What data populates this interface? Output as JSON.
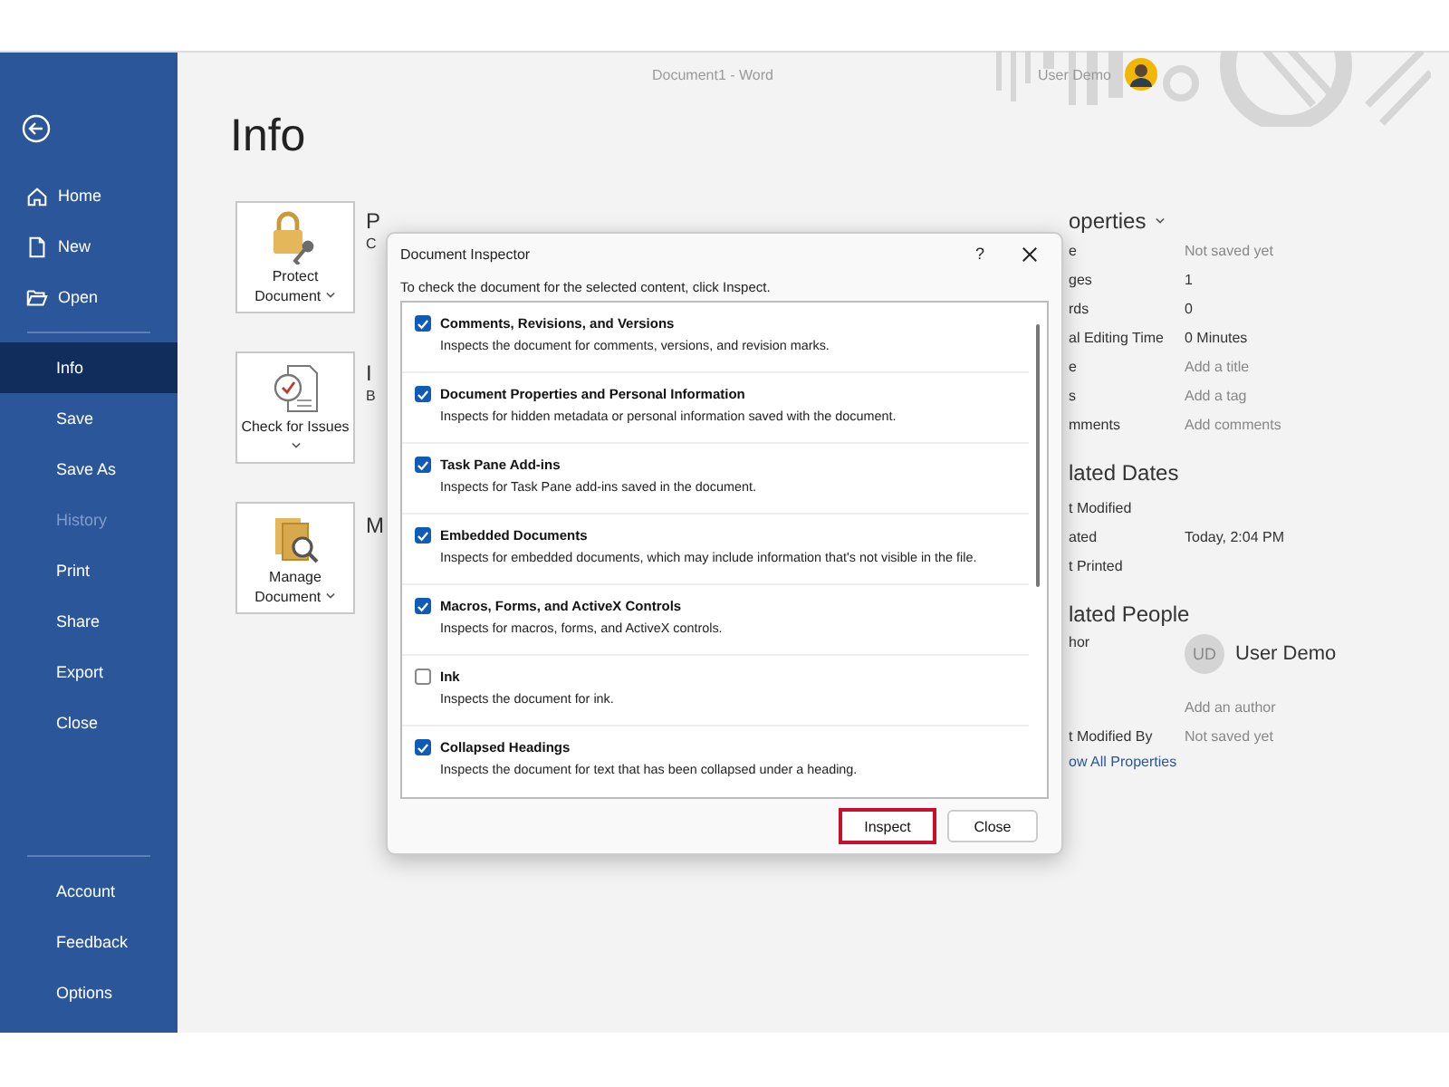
{
  "window": {
    "title": "Document1  -  Word",
    "user": "User Demo"
  },
  "sidebar": {
    "top": [
      {
        "label": "Home"
      },
      {
        "label": "New"
      },
      {
        "label": "Open"
      }
    ],
    "middle": [
      {
        "label": "Info",
        "selected": true,
        "disabled": false
      },
      {
        "label": "Save",
        "selected": false,
        "disabled": false
      },
      {
        "label": "Save As",
        "selected": false,
        "disabled": false
      },
      {
        "label": "History",
        "selected": false,
        "disabled": true
      },
      {
        "label": "Print",
        "selected": false,
        "disabled": false
      },
      {
        "label": "Share",
        "selected": false,
        "disabled": false
      },
      {
        "label": "Export",
        "selected": false,
        "disabled": false
      },
      {
        "label": "Close",
        "selected": false,
        "disabled": false
      }
    ],
    "bottom": [
      {
        "label": "Account"
      },
      {
        "label": "Feedback"
      },
      {
        "label": "Options"
      }
    ]
  },
  "page_title": "Info",
  "tools": [
    {
      "label": "Protect Document",
      "fragments": [
        "P",
        "C"
      ]
    },
    {
      "label": "Check for Issues",
      "fragments": [
        "I",
        "B"
      ]
    },
    {
      "label": "Manage Document",
      "fragments": [
        "M"
      ]
    }
  ],
  "properties": {
    "heading": "operties",
    "rows": [
      {
        "label": "e",
        "value": "Not saved yet",
        "muted": true
      },
      {
        "label": "ges",
        "value": "1",
        "muted": false
      },
      {
        "label": "rds",
        "value": "0",
        "muted": false
      },
      {
        "label": "al Editing Time",
        "value": "0 Minutes",
        "muted": false
      },
      {
        "label": "e",
        "value": "Add a title",
        "muted": true
      },
      {
        "label": "s",
        "value": "Add a tag",
        "muted": true
      },
      {
        "label": "mments",
        "value": "Add comments",
        "muted": true
      }
    ],
    "dates_heading": "lated Dates",
    "dates": [
      {
        "label": "t Modified"
      },
      {
        "label": "ated",
        "value": "Today, 2:04 PM"
      },
      {
        "label": "t Printed"
      }
    ],
    "people_heading": "lated People",
    "author_label": "hor",
    "author_initials": "UD",
    "author_name": "User Demo",
    "add_author": "Add an author",
    "modified_by_label": "t Modified By",
    "modified_by_value": "Not saved yet",
    "link": "ow All Properties"
  },
  "dialog": {
    "title": "Document Inspector",
    "help": "?",
    "instruction": "To check the document for the selected content, click Inspect.",
    "items": [
      {
        "title": "Comments, Revisions, and Versions",
        "description": "Inspects the document for comments, versions, and revision marks.",
        "checked": true
      },
      {
        "title": "Document Properties and Personal Information",
        "description": "Inspects for hidden metadata or personal information saved with the document.",
        "checked": true
      },
      {
        "title": "Task Pane Add-ins",
        "description": "Inspects for Task Pane add-ins saved in the document.",
        "checked": true
      },
      {
        "title": "Embedded Documents",
        "description": "Inspects for embedded documents, which may include information that's not visible in the file.",
        "checked": true
      },
      {
        "title": "Macros, Forms, and ActiveX Controls",
        "description": "Inspects for macros, forms, and ActiveX controls.",
        "checked": true
      },
      {
        "title": "Ink",
        "description": "Inspects the document for ink.",
        "checked": false
      },
      {
        "title": "Collapsed Headings",
        "description": "Inspects the document for text that has been collapsed under a heading.",
        "checked": true
      }
    ],
    "buttons": [
      {
        "label": "Inspect",
        "highlighted": true
      },
      {
        "label": "Close",
        "highlighted": false
      }
    ]
  }
}
